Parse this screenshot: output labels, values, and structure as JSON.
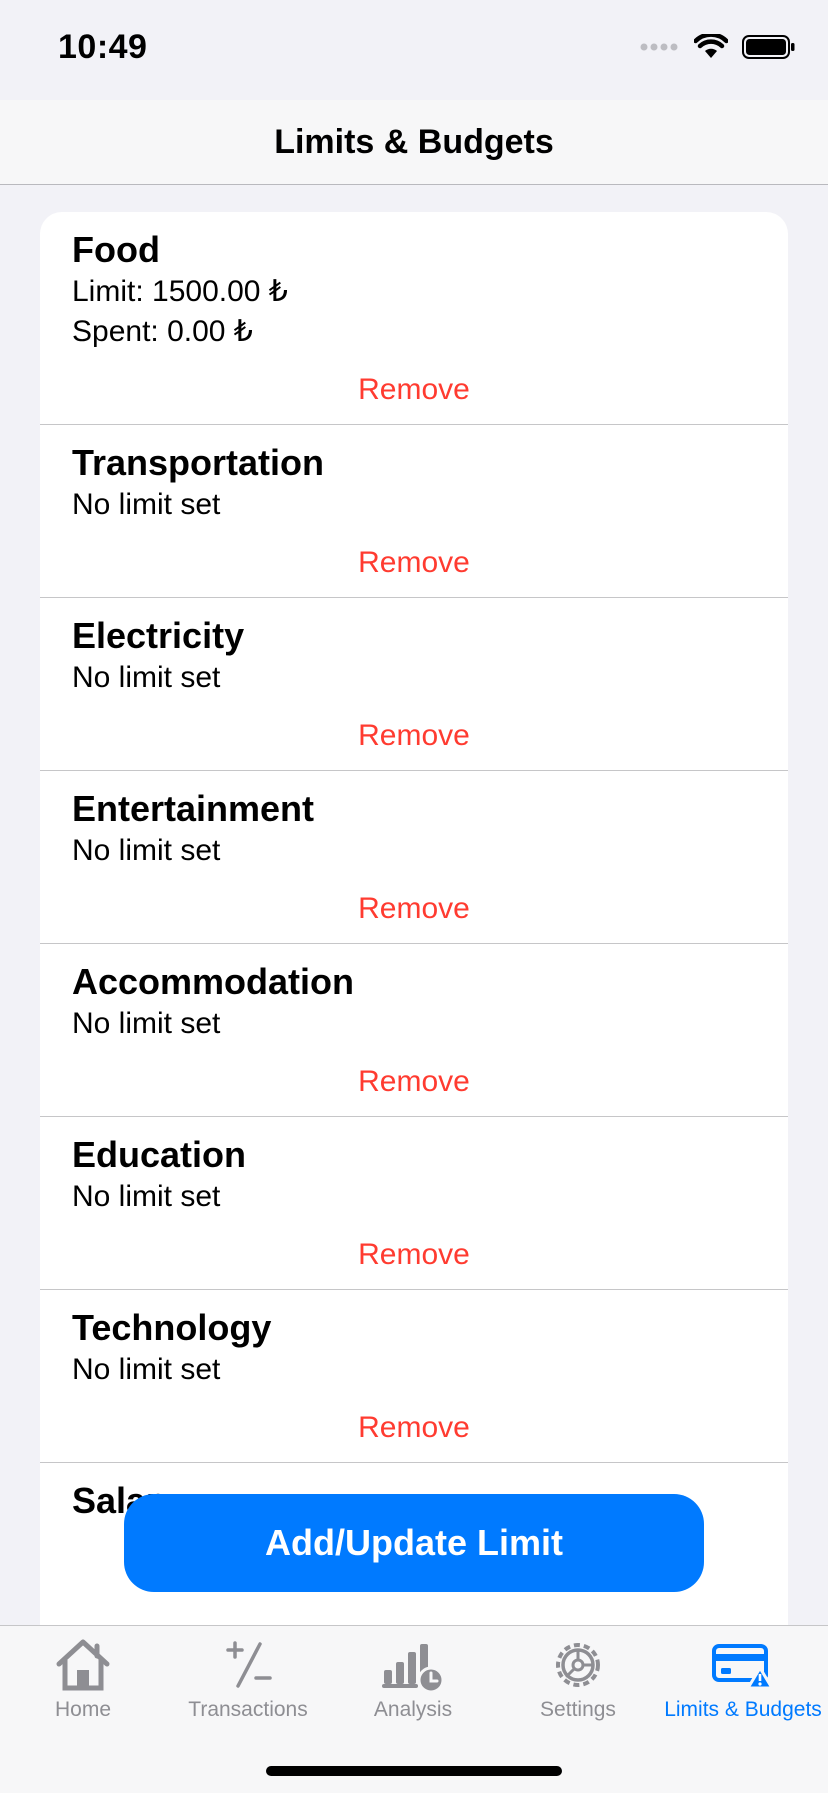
{
  "status": {
    "time": "10:49"
  },
  "header": {
    "title": "Limits & Budgets"
  },
  "categories": [
    {
      "name": "Food",
      "line1": "Limit: 1500.00 ₺",
      "line2": "Spent: 0.00 ₺",
      "remove": "Remove"
    },
    {
      "name": "Transportation",
      "line1": "No limit set",
      "remove": "Remove"
    },
    {
      "name": "Electricity",
      "line1": "No limit set",
      "remove": "Remove"
    },
    {
      "name": "Entertainment",
      "line1": "No limit set",
      "remove": "Remove"
    },
    {
      "name": "Accommodation",
      "line1": "No limit set",
      "remove": "Remove"
    },
    {
      "name": "Education",
      "line1": "No limit set",
      "remove": "Remove"
    },
    {
      "name": "Technology",
      "line1": "No limit set",
      "remove": "Remove"
    },
    {
      "name": "Salary"
    }
  ],
  "add_button": "Add/Update Limit",
  "tabs": [
    {
      "label": "Home",
      "icon": "house-icon"
    },
    {
      "label": "Transactions",
      "icon": "plus-minus-icon"
    },
    {
      "label": "Analysis",
      "icon": "chart-clock-icon"
    },
    {
      "label": "Settings",
      "icon": "gear-icon"
    },
    {
      "label": "Limits & Budgets",
      "icon": "card-warning-icon"
    }
  ],
  "colors": {
    "accent": "#007aff",
    "destructive": "#ff3b30",
    "inactive": "#8e8e93"
  }
}
